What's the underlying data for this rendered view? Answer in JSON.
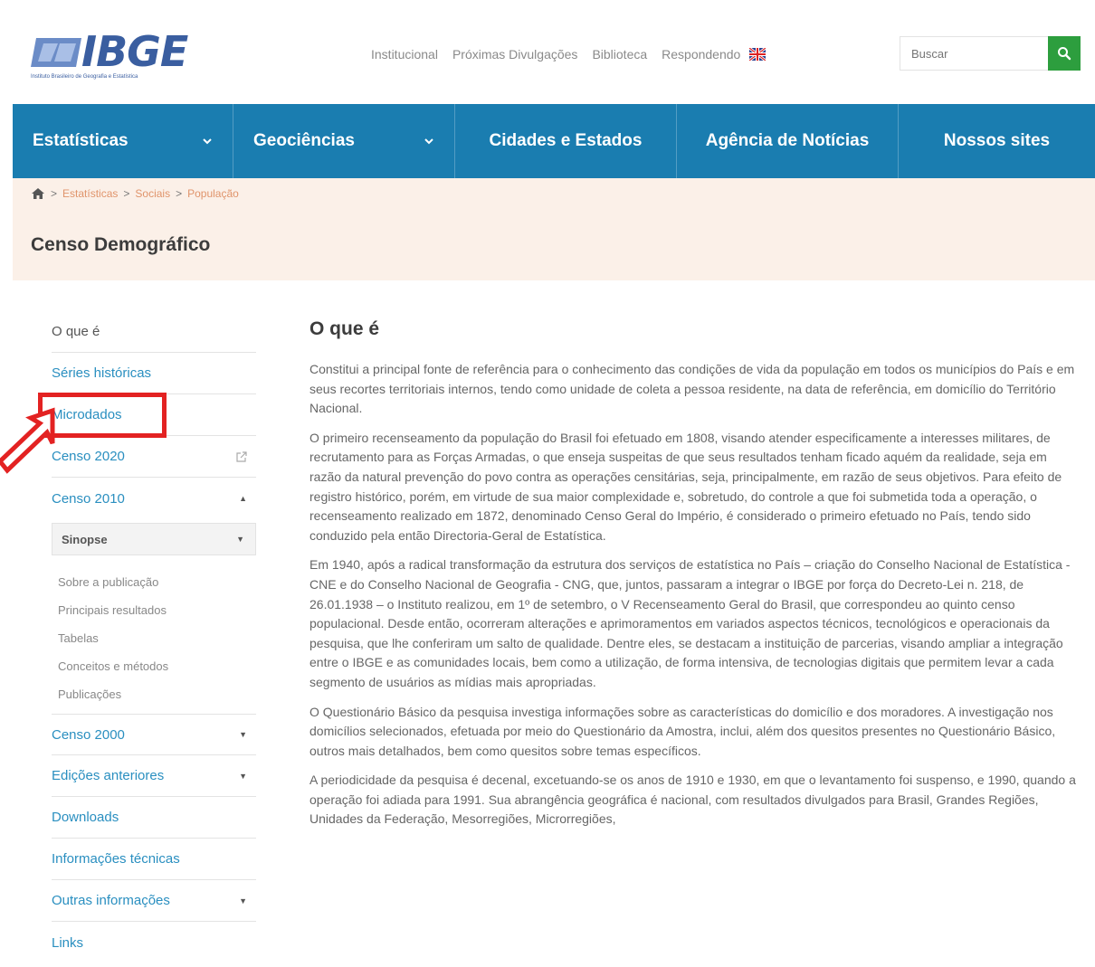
{
  "header": {
    "logo_text": "IBGE",
    "logo_subtitle": "Instituto Brasileiro de Geografia e Estatística",
    "top_links": [
      "Institucional",
      "Próximas Divulgações",
      "Biblioteca",
      "Respondendo"
    ],
    "search_placeholder": "Buscar"
  },
  "main_nav": [
    {
      "label": "Estatísticas",
      "dropdown": true
    },
    {
      "label": "Geociências",
      "dropdown": true
    },
    {
      "label": "Cidades e Estados",
      "dropdown": false
    },
    {
      "label": "Agência de Notícias",
      "dropdown": false
    },
    {
      "label": "Nossos sites",
      "dropdown": false
    }
  ],
  "breadcrumb": [
    "Estatísticas",
    "Sociais",
    "População"
  ],
  "page_title": "Censo Demográfico",
  "sidebar": {
    "items": [
      {
        "label": "O que é"
      },
      {
        "label": "Séries históricas"
      },
      {
        "label": "Microdados"
      },
      {
        "label": "Censo 2020"
      },
      {
        "label": "Censo 2010"
      }
    ],
    "subhead": "Sinopse",
    "sub_items": [
      "Sobre a publicação",
      "Principais resultados",
      "Tabelas",
      "Conceitos e métodos",
      "Publicações"
    ],
    "items_after": [
      {
        "label": "Censo 2000"
      },
      {
        "label": "Edições anteriores"
      },
      {
        "label": "Downloads"
      },
      {
        "label": "Informações técnicas"
      },
      {
        "label": "Outras informações"
      },
      {
        "label": "Links"
      }
    ]
  },
  "content": {
    "heading": "O que é",
    "paragraphs": [
      "Constitui a principal fonte de referência para o conhecimento das condições de vida da população em todos os municípios do País e em seus recortes territoriais internos, tendo como unidade de coleta a pessoa residente, na data de referência, em domicílio do Território Nacional.",
      "O primeiro recenseamento da população do Brasil foi efetuado em 1808, visando atender especificamente a interesses militares, de recrutamento para as Forças Armadas, o que enseja suspeitas de que seus resultados tenham ficado aquém da realidade, seja em razão da natural prevenção do povo contra as operações censitárias, seja, principalmente, em razão de seus objetivos. Para efeito de registro histórico, porém, em virtude de sua maior complexidade e, sobretudo, do controle a que foi submetida toda a operação, o recenseamento realizado em 1872, denominado Censo Geral do Império, é considerado o primeiro efetuado no País, tendo sido conduzido pela então Directoria-Geral de Estatística.",
      "Em 1940, após a radical transformação da estrutura dos serviços de estatística no País – criação do Conselho Nacional de Estatística - CNE e do Conselho Nacional de Geografia - CNG, que, juntos, passaram a integrar o IBGE por força do Decreto-Lei n. 218, de 26.01.1938 – o  Instituto realizou, em 1º de setembro, o V Recenseamento Geral do Brasil, que correspondeu ao quinto censo populacional. Desde então, ocorreram alterações e aprimoramentos em variados aspectos técnicos, tecnológicos e operacionais da pesquisa, que lhe conferiram um salto de qualidade.   Dentre eles, se destacam a instituição de parcerias, visando ampliar a integração entre o IBGE e as comunidades locais, bem como a utilização, de forma intensiva, de tecnologias digitais que permitem levar a cada segmento de usuários as mídias mais apropriadas.",
      "O Questionário Básico da pesquisa investiga informações sobre as características do domicílio e dos moradores. A investigação nos domicílios selecionados, efetuada por meio do Questionário da Amostra, inclui, além dos quesitos presentes no Questionário Básico, outros mais detalhados, bem como quesitos sobre temas específicos.",
      "A periodicidade da pesquisa é decenal, excetuando-se os anos de 1910 e 1930, em que o levantamento foi suspenso, e 1990, quando a operação foi adiada para 1991. Sua abrangência geográfica é nacional, com resultados divulgados para Brasil, Grandes Regiões, Unidades da Federação, Mesorregiões, Microrregiões,"
    ]
  },
  "colors": {
    "nav_blue": "#1a7db0",
    "band_peach": "#fbf0e8",
    "link_blue": "#2a8fc0",
    "breadcrumb_orange": "#e0946b",
    "search_green": "#2d9e3e",
    "annotation_red": "#e32222"
  }
}
